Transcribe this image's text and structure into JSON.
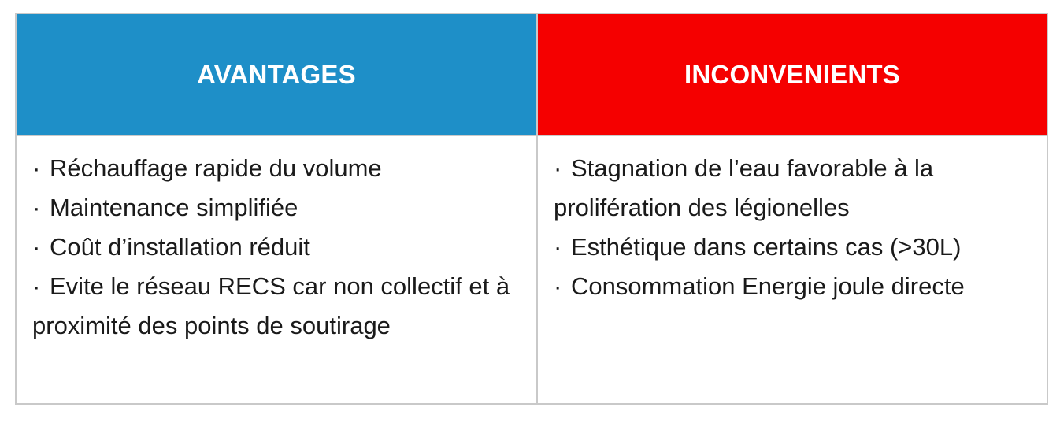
{
  "table": {
    "columns": [
      {
        "header": "AVANTAGES",
        "color": "#1e8fc8",
        "items": [
          "Réchauffage rapide du volume",
          "Maintenance simplifiée",
          "Coût d’installation réduit",
          "Evite le réseau RECS car non collectif et à proximité des points de soutirage"
        ]
      },
      {
        "header": "INCONVENIENTS",
        "color": "#f50000",
        "items": [
          "Stagnation de l’eau favorable à la prolifération des légionelles",
          "Esthétique dans certains cas (>30L)",
          "Consommation Energie joule directe"
        ]
      }
    ],
    "bullet": "·"
  }
}
